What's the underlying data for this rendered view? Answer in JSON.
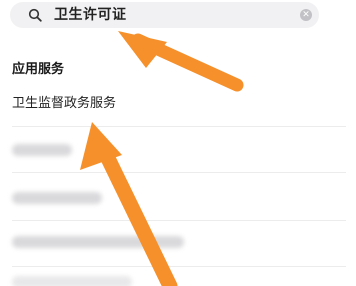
{
  "search": {
    "value": "卫生许可证",
    "icon": "search-icon",
    "clear_icon": "clear-icon"
  },
  "section": {
    "title": "应用服务"
  },
  "results": [
    {
      "label": "卫生监督政务服务"
    }
  ],
  "colors": {
    "arrow": "#f5902b",
    "search_bg": "#f1f1f3"
  }
}
